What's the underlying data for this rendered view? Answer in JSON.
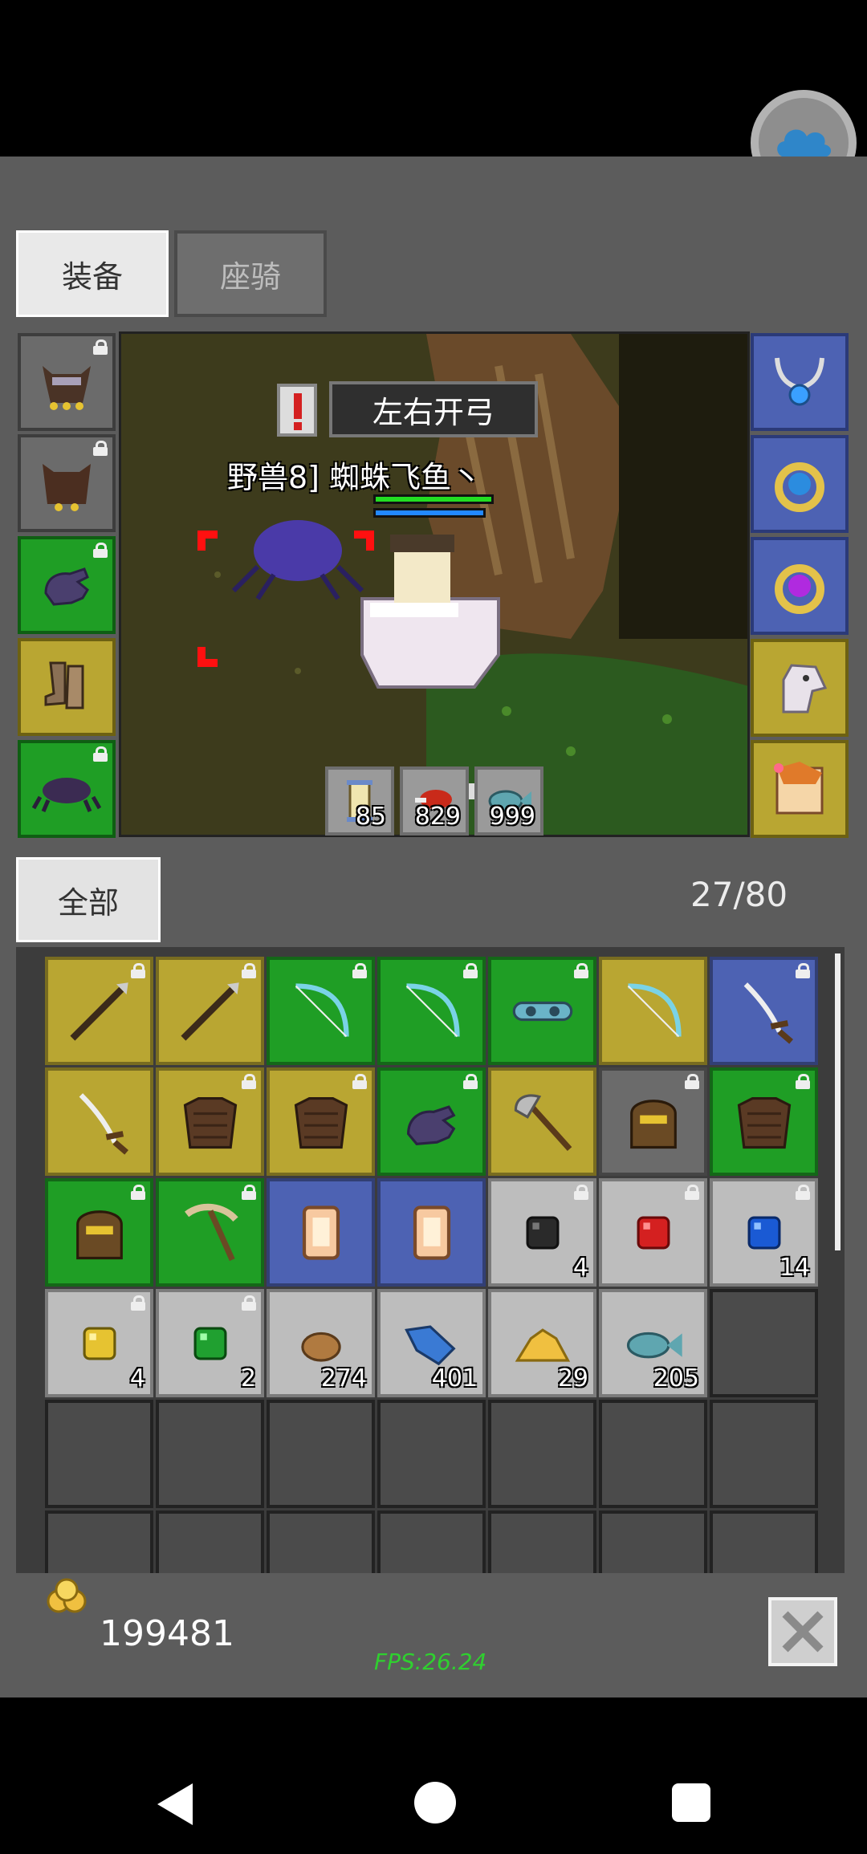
{
  "tabs": {
    "equip": "装备",
    "mount": "座骑"
  },
  "scene": {
    "skill_bubble": "左右开弓",
    "target_name": "野兽8] 蜘蛛飞鱼丶"
  },
  "quick_items": [
    {
      "icon": "scroll-icon",
      "count": "85"
    },
    {
      "icon": "meat-icon",
      "count": "829"
    },
    {
      "icon": "fish-icon",
      "count": "999"
    }
  ],
  "filter_label": "全部",
  "capacity": "27/80",
  "inventory": [
    [
      {
        "r": "yellow",
        "icon": "spear-icon",
        "lock": true
      },
      {
        "r": "yellow",
        "icon": "spear-icon",
        "lock": true
      },
      {
        "r": "green",
        "icon": "bow-icon",
        "lock": true
      },
      {
        "r": "green",
        "icon": "bow-icon",
        "lock": true
      },
      {
        "r": "green",
        "icon": "goggles-icon",
        "lock": true
      },
      {
        "r": "yellow",
        "icon": "bow-icon",
        "lock": false
      },
      {
        "r": "blue",
        "icon": "sword-icon",
        "lock": true
      }
    ],
    [
      {
        "r": "yellow",
        "icon": "sword-icon",
        "lock": false
      },
      {
        "r": "yellow",
        "icon": "armor-icon",
        "lock": true
      },
      {
        "r": "yellow",
        "icon": "armor-icon",
        "lock": true
      },
      {
        "r": "green",
        "icon": "glove-icon",
        "lock": true
      },
      {
        "r": "yellow",
        "icon": "axe-icon",
        "lock": false
      },
      {
        "r": "gray",
        "icon": "helmet-icon",
        "lock": true
      },
      {
        "r": "green",
        "icon": "armor-icon",
        "lock": true
      }
    ],
    [
      {
        "r": "green",
        "icon": "helmet-icon",
        "lock": true
      },
      {
        "r": "green",
        "icon": "pickaxe-icon",
        "lock": true
      },
      {
        "r": "blue",
        "icon": "scroll-card-icon",
        "lock": false
      },
      {
        "r": "blue",
        "icon": "scroll-card-icon",
        "lock": false
      },
      {
        "r": "light",
        "icon": "black-gem-icon",
        "lock": true,
        "count": "4"
      },
      {
        "r": "light",
        "icon": "red-gem-icon",
        "lock": true
      },
      {
        "r": "light",
        "icon": "blue-gem-icon",
        "lock": true,
        "count": "14"
      }
    ],
    [
      {
        "r": "light",
        "icon": "yellow-gem-icon",
        "lock": true,
        "count": "4"
      },
      {
        "r": "light",
        "icon": "green-gem-icon",
        "lock": true,
        "count": "2"
      },
      {
        "r": "light",
        "icon": "ore-icon",
        "lock": false,
        "count": "274"
      },
      {
        "r": "light",
        "icon": "blue-fish-icon",
        "lock": false,
        "count": "401"
      },
      {
        "r": "light",
        "icon": "gold-pile-icon",
        "lock": false,
        "count": "29"
      },
      {
        "r": "light",
        "icon": "fish-icon",
        "lock": false,
        "count": "205"
      },
      {
        "r": "empty"
      }
    ],
    [
      {
        "r": "empty"
      },
      {
        "r": "empty"
      },
      {
        "r": "empty"
      },
      {
        "r": "empty"
      },
      {
        "r": "empty"
      },
      {
        "r": "empty"
      },
      {
        "r": "empty"
      }
    ],
    [
      {
        "r": "empty"
      },
      {
        "r": "empty"
      },
      {
        "r": "empty"
      },
      {
        "r": "empty"
      },
      {
        "r": "empty"
      },
      {
        "r": "empty"
      },
      {
        "r": "empty"
      }
    ]
  ],
  "gold": "199481",
  "fps": "FPS:26.24",
  "colors": {
    "green": "#1f9e25",
    "yellow": "#b9a632",
    "blue": "#4d62b3",
    "light": "#bdbdbd",
    "gray": "#6b6b6b",
    "empty": "#4b4b4b"
  }
}
